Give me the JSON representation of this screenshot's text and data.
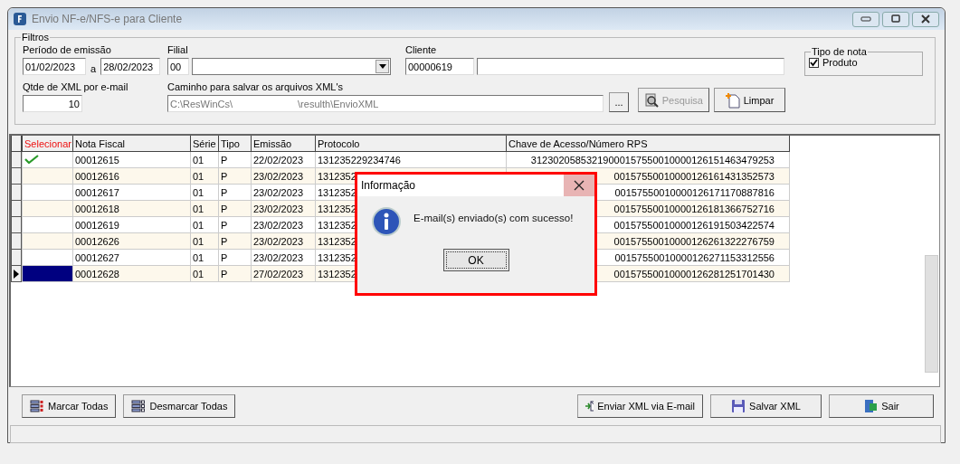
{
  "window": {
    "title": "Envio NF-e/NFS-e para Cliente"
  },
  "filters": {
    "title": "Filtros",
    "period_label": "Período de emissão",
    "date_from": "01/02/2023",
    "date_separator": "a",
    "date_to": "28/02/2023",
    "branch_label": "Filial",
    "branch_code": "00",
    "client_label": "Cliente",
    "client_code": "00000619",
    "qty_label": "Qtde de XML por e-mail",
    "qty_value": "10",
    "path_label": "Caminho para salvar os arquivos XML's",
    "path_start": "C:\\ResWinCs\\",
    "path_end": "\\resulth\\EnvioXML",
    "browse_button": "...",
    "search_button": {
      "label": "Pesquisa",
      "disabled": true
    },
    "clear_button": {
      "label": "Limpar",
      "disabled": false
    }
  },
  "note_type": {
    "title": "Tipo de nota",
    "options": [
      {
        "label": "Produto",
        "checked": true
      }
    ]
  },
  "table": {
    "select_header": "Selecionar",
    "columns": [
      "Nota Fiscal",
      "Série",
      "Tipo",
      "Emissão",
      "Protocolo",
      "Chave de Acesso/Número RPS"
    ],
    "rows": [
      {
        "checked": true,
        "current": false,
        "cells": [
          "00012615",
          "01",
          "P",
          "22/02/2023",
          "131235229234746",
          "31230205853219000157550010000126151463479253"
        ]
      },
      {
        "checked": false,
        "current": false,
        "cells": [
          "00012616",
          "01",
          "P",
          "23/02/2023",
          "1312352",
          "00157550010000126161431352573"
        ]
      },
      {
        "checked": false,
        "current": false,
        "cells": [
          "00012617",
          "01",
          "P",
          "23/02/2023",
          "1312352",
          "00157550010000126171170887816"
        ]
      },
      {
        "checked": false,
        "current": false,
        "cells": [
          "00012618",
          "01",
          "P",
          "23/02/2023",
          "1312352",
          "00157550010000126181366752716"
        ]
      },
      {
        "checked": false,
        "current": false,
        "cells": [
          "00012619",
          "01",
          "P",
          "23/02/2023",
          "1312352",
          "00157550010000126191503422574"
        ]
      },
      {
        "checked": false,
        "current": false,
        "cells": [
          "00012626",
          "01",
          "P",
          "23/02/2023",
          "1312352",
          "00157550010000126261322276759"
        ]
      },
      {
        "checked": false,
        "current": false,
        "cells": [
          "00012627",
          "01",
          "P",
          "23/02/2023",
          "1312352",
          "00157550010000126271153312556"
        ]
      },
      {
        "checked": false,
        "current": true,
        "cells": [
          "00012628",
          "01",
          "P",
          "27/02/2023",
          "1312352",
          "00157550010000126281251701430"
        ]
      }
    ]
  },
  "bottom_left_buttons": [
    {
      "kind": "check-all",
      "label": "Marcar Todas"
    },
    {
      "kind": "uncheck-all",
      "label": "Desmarcar Todas"
    }
  ],
  "bottom_right_buttons": [
    {
      "kind": "email",
      "label": "Enviar XML via E-mail"
    },
    {
      "kind": "save",
      "label": "Salvar XML"
    },
    {
      "kind": "exit",
      "label": "Sair"
    }
  ],
  "dialog": {
    "title": "Informação",
    "message": "E-mail(s) enviado(s) com sucesso!",
    "button": "OK",
    "highlighted": true
  }
}
